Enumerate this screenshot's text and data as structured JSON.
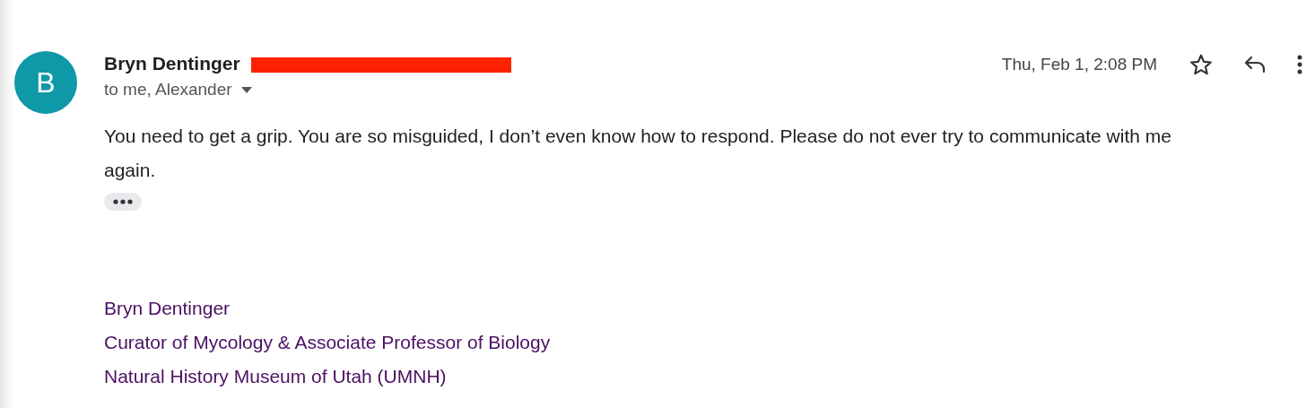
{
  "message": {
    "avatar_letter": "B",
    "sender": "Bryn Dentinger",
    "recipients": "to me, Alexander",
    "date": "Thu, Feb 1, 2:08 PM",
    "starred": false,
    "body": [
      "You need to get a grip. You are so misguided, I don’t even know how to respond. Please do not ever try to communicate with me again."
    ],
    "signature": [
      "Bryn Dentinger",
      "Curator of Mycology & Associate Professor of Biology",
      "Natural History Museum of Utah (UMNH)"
    ]
  }
}
